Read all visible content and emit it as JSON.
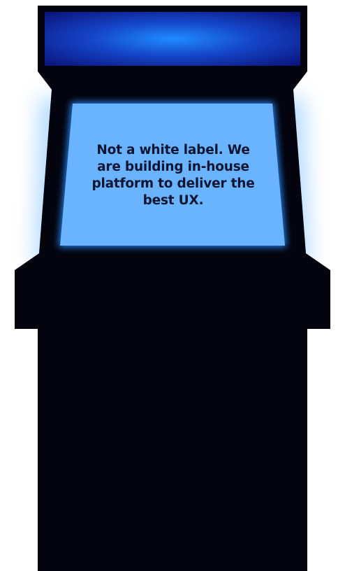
{
  "screen": {
    "message": "Not a white label. We are building in-house platform to deliver the best UX."
  },
  "colors": {
    "cabinet_body": "#03040e",
    "marquee_dark": "#0a137a",
    "marquee_glow": "#1f8dff",
    "screen_fill": "#6ab4ff",
    "screen_glow": "#2a8cff",
    "screen_text": "#0d1530"
  }
}
